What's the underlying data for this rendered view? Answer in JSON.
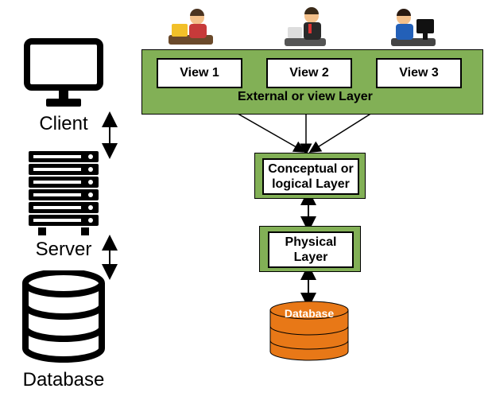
{
  "left": {
    "client_label": "Client",
    "server_label": "Server",
    "database_label": "Database"
  },
  "external_layer": {
    "view1_label": "View 1",
    "view2_label": "View 2",
    "view3_label": "View 3",
    "title": "External or view Layer"
  },
  "conceptual_layer": {
    "title": "Conceptual or\nlogical Layer"
  },
  "physical_layer": {
    "title": "Physical\nLayer"
  },
  "storage": {
    "title": "Database"
  },
  "meta": {
    "type": "three-schema-architecture",
    "tiers_left": [
      "Client",
      "Server",
      "Database"
    ],
    "layers_right": [
      "External or view Layer",
      "Conceptual or logical Layer",
      "Physical Layer",
      "Database"
    ]
  }
}
